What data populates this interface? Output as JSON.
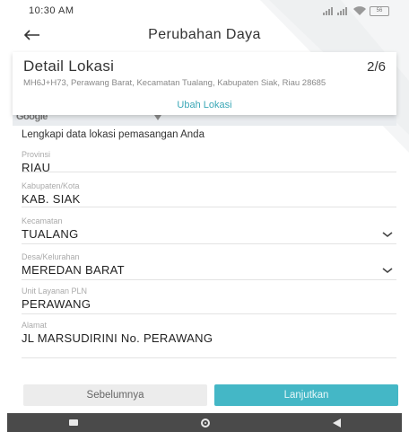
{
  "status": {
    "time": "10:30 AM",
    "battery": "56"
  },
  "header": {
    "title": "Perubahan Daya"
  },
  "location_card": {
    "title": "Detail Lokasi",
    "step": "2/6",
    "address": "MH6J+H73, Perawang Barat, Kecamatan Tualang, Kabupaten Siak, Riau 28685",
    "change_label": "Ubah Lokasi"
  },
  "map": {
    "provider": "Google"
  },
  "form": {
    "intro": "Lengkapi data lokasi pemasangan Anda",
    "fields": [
      {
        "label": "Provinsi",
        "value": "RIAU"
      },
      {
        "label": "Kabupaten/Kota",
        "value": "KAB. SIAK"
      },
      {
        "label": "Kecamatan",
        "value": "TUALANG"
      },
      {
        "label": "Desa/Kelurahan",
        "value": "MEREDAN BARAT"
      },
      {
        "label": "Unit Layanan PLN",
        "value": "PERAWANG"
      },
      {
        "label": "Alamat",
        "value": "JL MARSUDIRINI No. PERAWANG"
      }
    ]
  },
  "buttons": {
    "previous": "Sebelumnya",
    "next": "Lanjutkan"
  },
  "colors": {
    "accent": "#44b7c6",
    "link": "#3aa7b6",
    "nav_bar": "#4a4a4a"
  }
}
